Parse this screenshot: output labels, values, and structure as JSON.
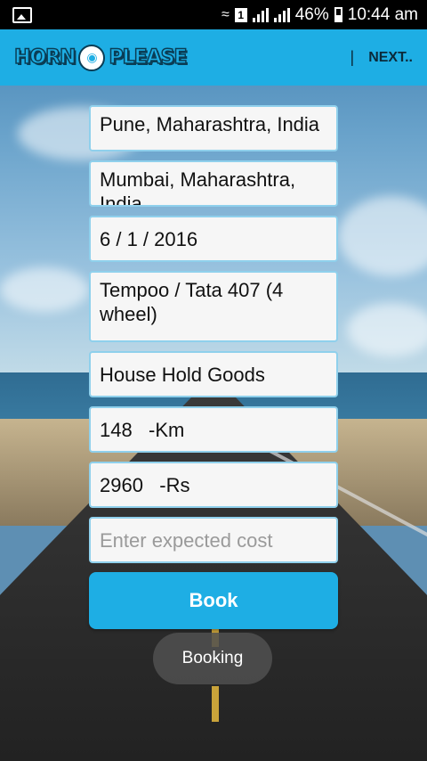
{
  "status_bar": {
    "battery": "46%",
    "time": "10:44 am",
    "sim_slot": "1"
  },
  "app_bar": {
    "logo_left": "HORN",
    "logo_right": "PLEASE",
    "separator": "|",
    "next_label": "NEXT.."
  },
  "form": {
    "from": "Pune, Maharashtra, India",
    "to": "Mumbai, Maharashtra, India",
    "date": "6 / 1 / 2016",
    "vehicle": "Tempoo / Tata 407 (4 wheel)",
    "goods": "House Hold Goods",
    "distance": "148   -Km",
    "price": "2960   -Rs",
    "expected_cost_placeholder": "Enter expected cost",
    "book_label": "Book"
  },
  "toast": "Booking",
  "colors": {
    "accent": "#1eaee4",
    "status_bar": "#000000",
    "field_bg": "#f6f6f6"
  }
}
